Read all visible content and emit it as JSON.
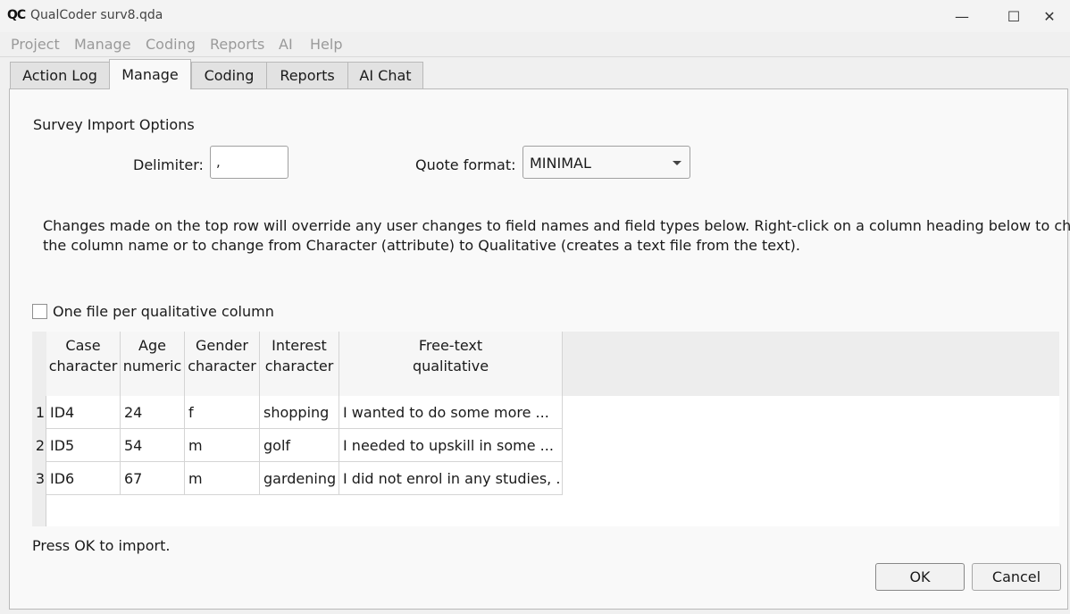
{
  "window": {
    "title": "QualCoder surv8.qda",
    "logo": "QC",
    "minimize": "—",
    "maximize": "☐",
    "close": "✕"
  },
  "menu": [
    "Project",
    "Manage",
    "Coding",
    "Reports",
    "AI",
    "Help"
  ],
  "tabs": [
    "Action Log",
    "Manage",
    "Coding",
    "Reports",
    "AI Chat"
  ],
  "active_tab": "Manage",
  "dialog": {
    "heading": "Survey Import Options",
    "delimiter_label": "Delimiter:",
    "delimiter_value": ",",
    "quote_label": "Quote format:",
    "quote_value": "MINIMAL",
    "info_line1": "Changes made on the top row will override any user changes to field names and field types below. Right-click on a column heading below to change",
    "info_line2": "the column name or to change from Character (attribute) to Qualitative (creates a text file from the text).",
    "checkbox_label": "One file per qualitative column",
    "checkbox_checked": false,
    "footer_text": "Press OK to import.",
    "ok_label": "OK",
    "cancel_label": "Cancel"
  },
  "table": {
    "columns": [
      {
        "line1": "Case",
        "line2": "character"
      },
      {
        "line1": "Age",
        "line2": "numeric"
      },
      {
        "line1": "Gender",
        "line2": "character"
      },
      {
        "line1": "Interest",
        "line2": "character"
      },
      {
        "line1": "Free-text",
        "line2": "qualitative"
      }
    ],
    "rows": [
      {
        "num": "1",
        "cells": [
          "ID4",
          "24",
          "f",
          "shopping",
          "I wanted to do some more ..."
        ]
      },
      {
        "num": "2",
        "cells": [
          "ID5",
          "54",
          "m",
          "golf",
          "I needed to upskill in some ..."
        ]
      },
      {
        "num": "3",
        "cells": [
          "ID6",
          "67",
          "m",
          "gardening",
          "I did not enrol in any studies, ..."
        ]
      }
    ]
  }
}
